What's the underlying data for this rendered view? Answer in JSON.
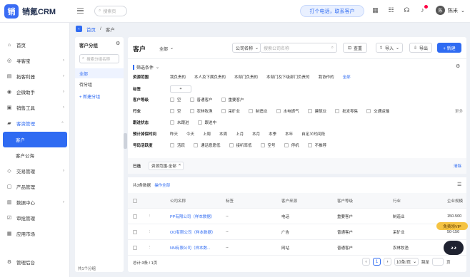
{
  "app": {
    "logo_letter": "销",
    "name": "销氪CRM"
  },
  "header": {
    "search_placeholder": "搜索页",
    "call_button": "打个电话，联系客户",
    "user_name": "陈米",
    "avatar_letter": "陈"
  },
  "sidebar": {
    "items": [
      {
        "label": "首页",
        "icon": "home-icon"
      },
      {
        "label": "寻客宝",
        "icon": "compass-icon"
      },
      {
        "label": "拓客利器",
        "icon": "toolbox-icon"
      },
      {
        "label": "企微助手",
        "icon": "wechat-icon"
      },
      {
        "label": "销售工具",
        "icon": "tools-icon"
      },
      {
        "label": "客资管理",
        "icon": "folder-icon"
      },
      {
        "label": "客户",
        "icon": ""
      },
      {
        "label": "客户公海",
        "icon": ""
      },
      {
        "label": "交易管理",
        "icon": "trade-icon"
      },
      {
        "label": "产品管理",
        "icon": "product-icon"
      },
      {
        "label": "数据中心",
        "icon": "data-icon"
      },
      {
        "label": "审批管理",
        "icon": "approve-icon"
      },
      {
        "label": "应用市场",
        "icon": "market-icon"
      },
      {
        "label": "管理后台",
        "icon": "admin-icon"
      }
    ]
  },
  "breadcrumb": {
    "home": "首页",
    "current": "客户"
  },
  "groups": {
    "title": "客户分组",
    "search_placeholder": "搜索分组名称",
    "items": [
      "全部",
      "待分组"
    ],
    "new_group": "+ 新建分组",
    "footer": "共1个分组"
  },
  "main": {
    "title": "客户",
    "view_select": "全部",
    "search_type": "公司名称",
    "search_placeholder": "搜索公司名称",
    "query_button": "查重",
    "import_button": "导入",
    "export_button": "导出",
    "new_button": "+ 新建",
    "filter_title": "筛选条件",
    "filters": {
      "scope": {
        "label": "资源范围",
        "options": [
          "我负责的",
          "本人及下属负责的",
          "本部门负责的",
          "本部门及下级部门负责的",
          "我协作的",
          "全部"
        ]
      },
      "tag": {
        "label": "标签",
        "add": "+"
      },
      "level": {
        "label": "客户等级",
        "options": [
          "空",
          "普通客户",
          "重要客户"
        ]
      },
      "industry": {
        "label": "行业",
        "options": [
          "空",
          "农林牧渔",
          "采矿业",
          "制造业",
          "水电燃气",
          "建筑业",
          "批发零售",
          "交通运输"
        ],
        "more": "更多"
      },
      "follow": {
        "label": "跟进状态",
        "options": [
          "未跟进",
          "跟进中"
        ]
      },
      "time": {
        "label": "预计掉保时间",
        "options": [
          "昨天",
          "今天",
          "上周",
          "本周",
          "上月",
          "本月",
          "本季",
          "本年",
          "自定义时间段"
        ]
      },
      "activity": {
        "label": "号码活跃度",
        "options": [
          "活跃",
          "通话意愿低",
          "接听率低",
          "空号",
          "停机",
          "不推荐"
        ]
      }
    },
    "selected": {
      "label": "已选",
      "chip": "资源范围-全部",
      "clear": "清除"
    },
    "summary": {
      "count_text": "共3条数据",
      "ops": "操作全部"
    },
    "table": {
      "headers": [
        "公司名称",
        "标签",
        "客户来源",
        "客户等级",
        "行业",
        "企业规模"
      ],
      "rows": [
        {
          "name": "PP有限公司（样本数据）",
          "tag": "--",
          "source": "电话",
          "level": "重要客户",
          "industry": "制造业",
          "scale": "150-500"
        },
        {
          "name": "OO有限公司（样本数据）",
          "tag": "--",
          "source": "广告",
          "level": "普通客户",
          "industry": "采矿业",
          "scale": "50-150"
        },
        {
          "name": "NN有限公司（样本数...",
          "tag": "--",
          "source": "网站",
          "level": "普通客户",
          "industry": "农林牧渔",
          "scale": "1-50"
        }
      ]
    },
    "pager": {
      "total": "总计:3条 / 1页",
      "page": "1",
      "size": "10条/页",
      "goto": "跳至",
      "unit": "页"
    }
  },
  "vip_badge": "免费领VIP"
}
